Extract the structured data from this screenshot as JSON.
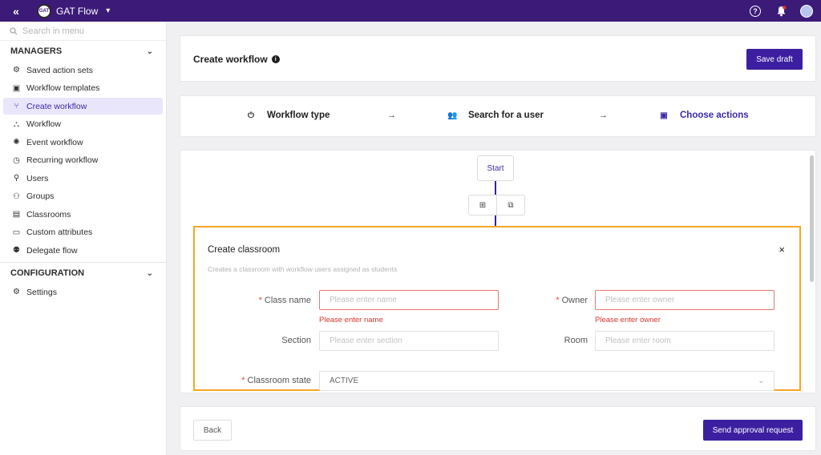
{
  "topbar": {
    "collapse_icon": "double-chevron-left-icon",
    "app_name": "GAT Flow",
    "logo_text": "GAT",
    "icons": [
      "help-icon",
      "bell-icon",
      "avatar"
    ]
  },
  "sidebar": {
    "search_placeholder": "Search in menu",
    "managers_label": "MANAGERS",
    "configuration_label": "CONFIGURATION",
    "manager_items": [
      {
        "label": "Saved action sets",
        "icon": "gears-icon"
      },
      {
        "label": "Workflow templates",
        "icon": "template-icon"
      },
      {
        "label": "Create workflow",
        "icon": "branch-icon",
        "active": true
      },
      {
        "label": "Workflow",
        "icon": "hierarchy-icon"
      },
      {
        "label": "Event workflow",
        "icon": "alarm-icon"
      },
      {
        "label": "Recurring workflow",
        "icon": "clock-icon"
      },
      {
        "label": "Users",
        "icon": "user-search-icon"
      },
      {
        "label": "Groups",
        "icon": "groups-icon"
      },
      {
        "label": "Classrooms",
        "icon": "classroom-icon"
      },
      {
        "label": "Custom attributes",
        "icon": "id-card-icon"
      },
      {
        "label": "Delegate flow",
        "icon": "delegate-icon"
      }
    ],
    "config_items": [
      {
        "label": "Settings",
        "icon": "gear-icon"
      }
    ]
  },
  "header": {
    "title": "Create workflow",
    "save_draft": "Save draft"
  },
  "steps": {
    "step1": "Workflow type",
    "step2": "Search for a user",
    "step3": "Choose actions"
  },
  "canvas": {
    "start_label": "Start"
  },
  "form": {
    "title": "Create classroom",
    "description": "Creates a classroom with workflow users assigned as students",
    "class_name_label": "Class name",
    "class_name_placeholder": "Please enter name",
    "class_name_error": "Please enter name",
    "owner_label": "Owner",
    "owner_placeholder": "Please enter owner",
    "owner_error": "Please enter owner",
    "section_label": "Section",
    "section_placeholder": "Please enter section",
    "room_label": "Room",
    "room_placeholder": "Please enter room",
    "state_label": "Classroom state",
    "state_value": "ACTIVE",
    "required_mark": "*",
    "close_glyph": "×"
  },
  "footer": {
    "back": "Back",
    "send": "Send approval request"
  },
  "colors": {
    "brand": "#3c1a78",
    "primary_button": "#3c1fa0",
    "active_text": "#3b2aa8",
    "error": "#d9362b",
    "highlight_border": "#f5a623"
  }
}
